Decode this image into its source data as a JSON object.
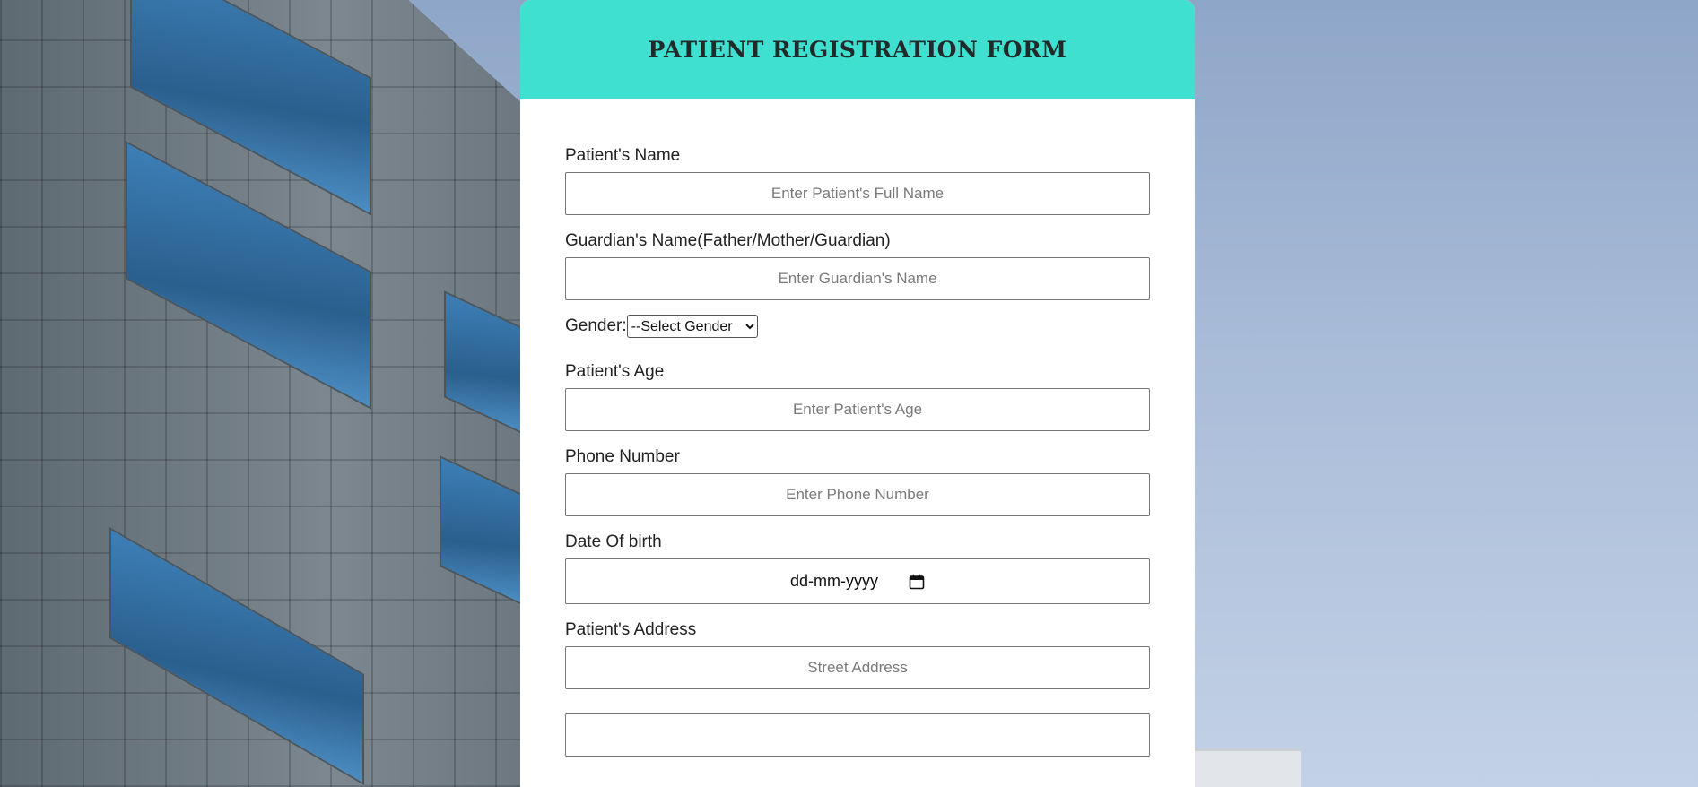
{
  "form": {
    "title": "PATIENT REGISTRATION FORM",
    "patient_name": {
      "label": "Patient's Name",
      "placeholder": "Enter Patient's Full Name",
      "value": ""
    },
    "guardian_name": {
      "label": "Guardian's Name(Father/Mother/Guardian)",
      "placeholder": "Enter Guardian's Name",
      "value": ""
    },
    "gender": {
      "label": "Gender:",
      "selected": "--Select Gender"
    },
    "age": {
      "label": "Patient's Age",
      "placeholder": "Enter Patient's Age",
      "value": ""
    },
    "phone": {
      "label": "Phone Number",
      "placeholder": "Enter Phone Number",
      "value": ""
    },
    "dob": {
      "label": "Date Of birth",
      "value": "dd-mm-yyyy",
      "icon": "calendar-icon"
    },
    "address": {
      "label": "Patient's Address",
      "street_placeholder": "Street Address"
    }
  },
  "colors": {
    "header_accent": "#40e0d0",
    "card_background": "#ffffff"
  }
}
